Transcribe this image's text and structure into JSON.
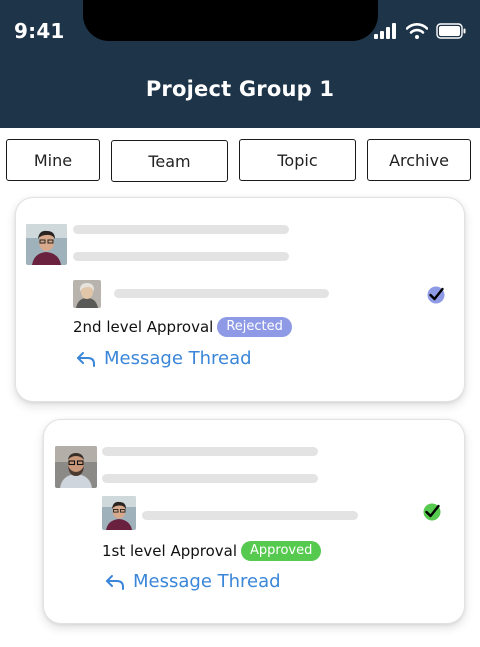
{
  "status_bar": {
    "time": "9:41"
  },
  "header": {
    "title": "Project Group 1"
  },
  "tabs": [
    {
      "label": "Mine"
    },
    {
      "label": "Team"
    },
    {
      "label": "Topic"
    },
    {
      "label": "Archive"
    }
  ],
  "cards": [
    {
      "approval_label": "2nd level Approval",
      "status": "Rejected",
      "status_color": "#8f9ae6",
      "check_color": "#8f9ae6",
      "thread_label": "Message Thread"
    },
    {
      "approval_label": "1st level Approval",
      "status": "Approved",
      "status_color": "#56c94f",
      "check_color": "#56c94f",
      "thread_label": "Message Thread"
    }
  ],
  "colors": {
    "header_bg": "#1e3448",
    "link": "#3a86d8"
  }
}
